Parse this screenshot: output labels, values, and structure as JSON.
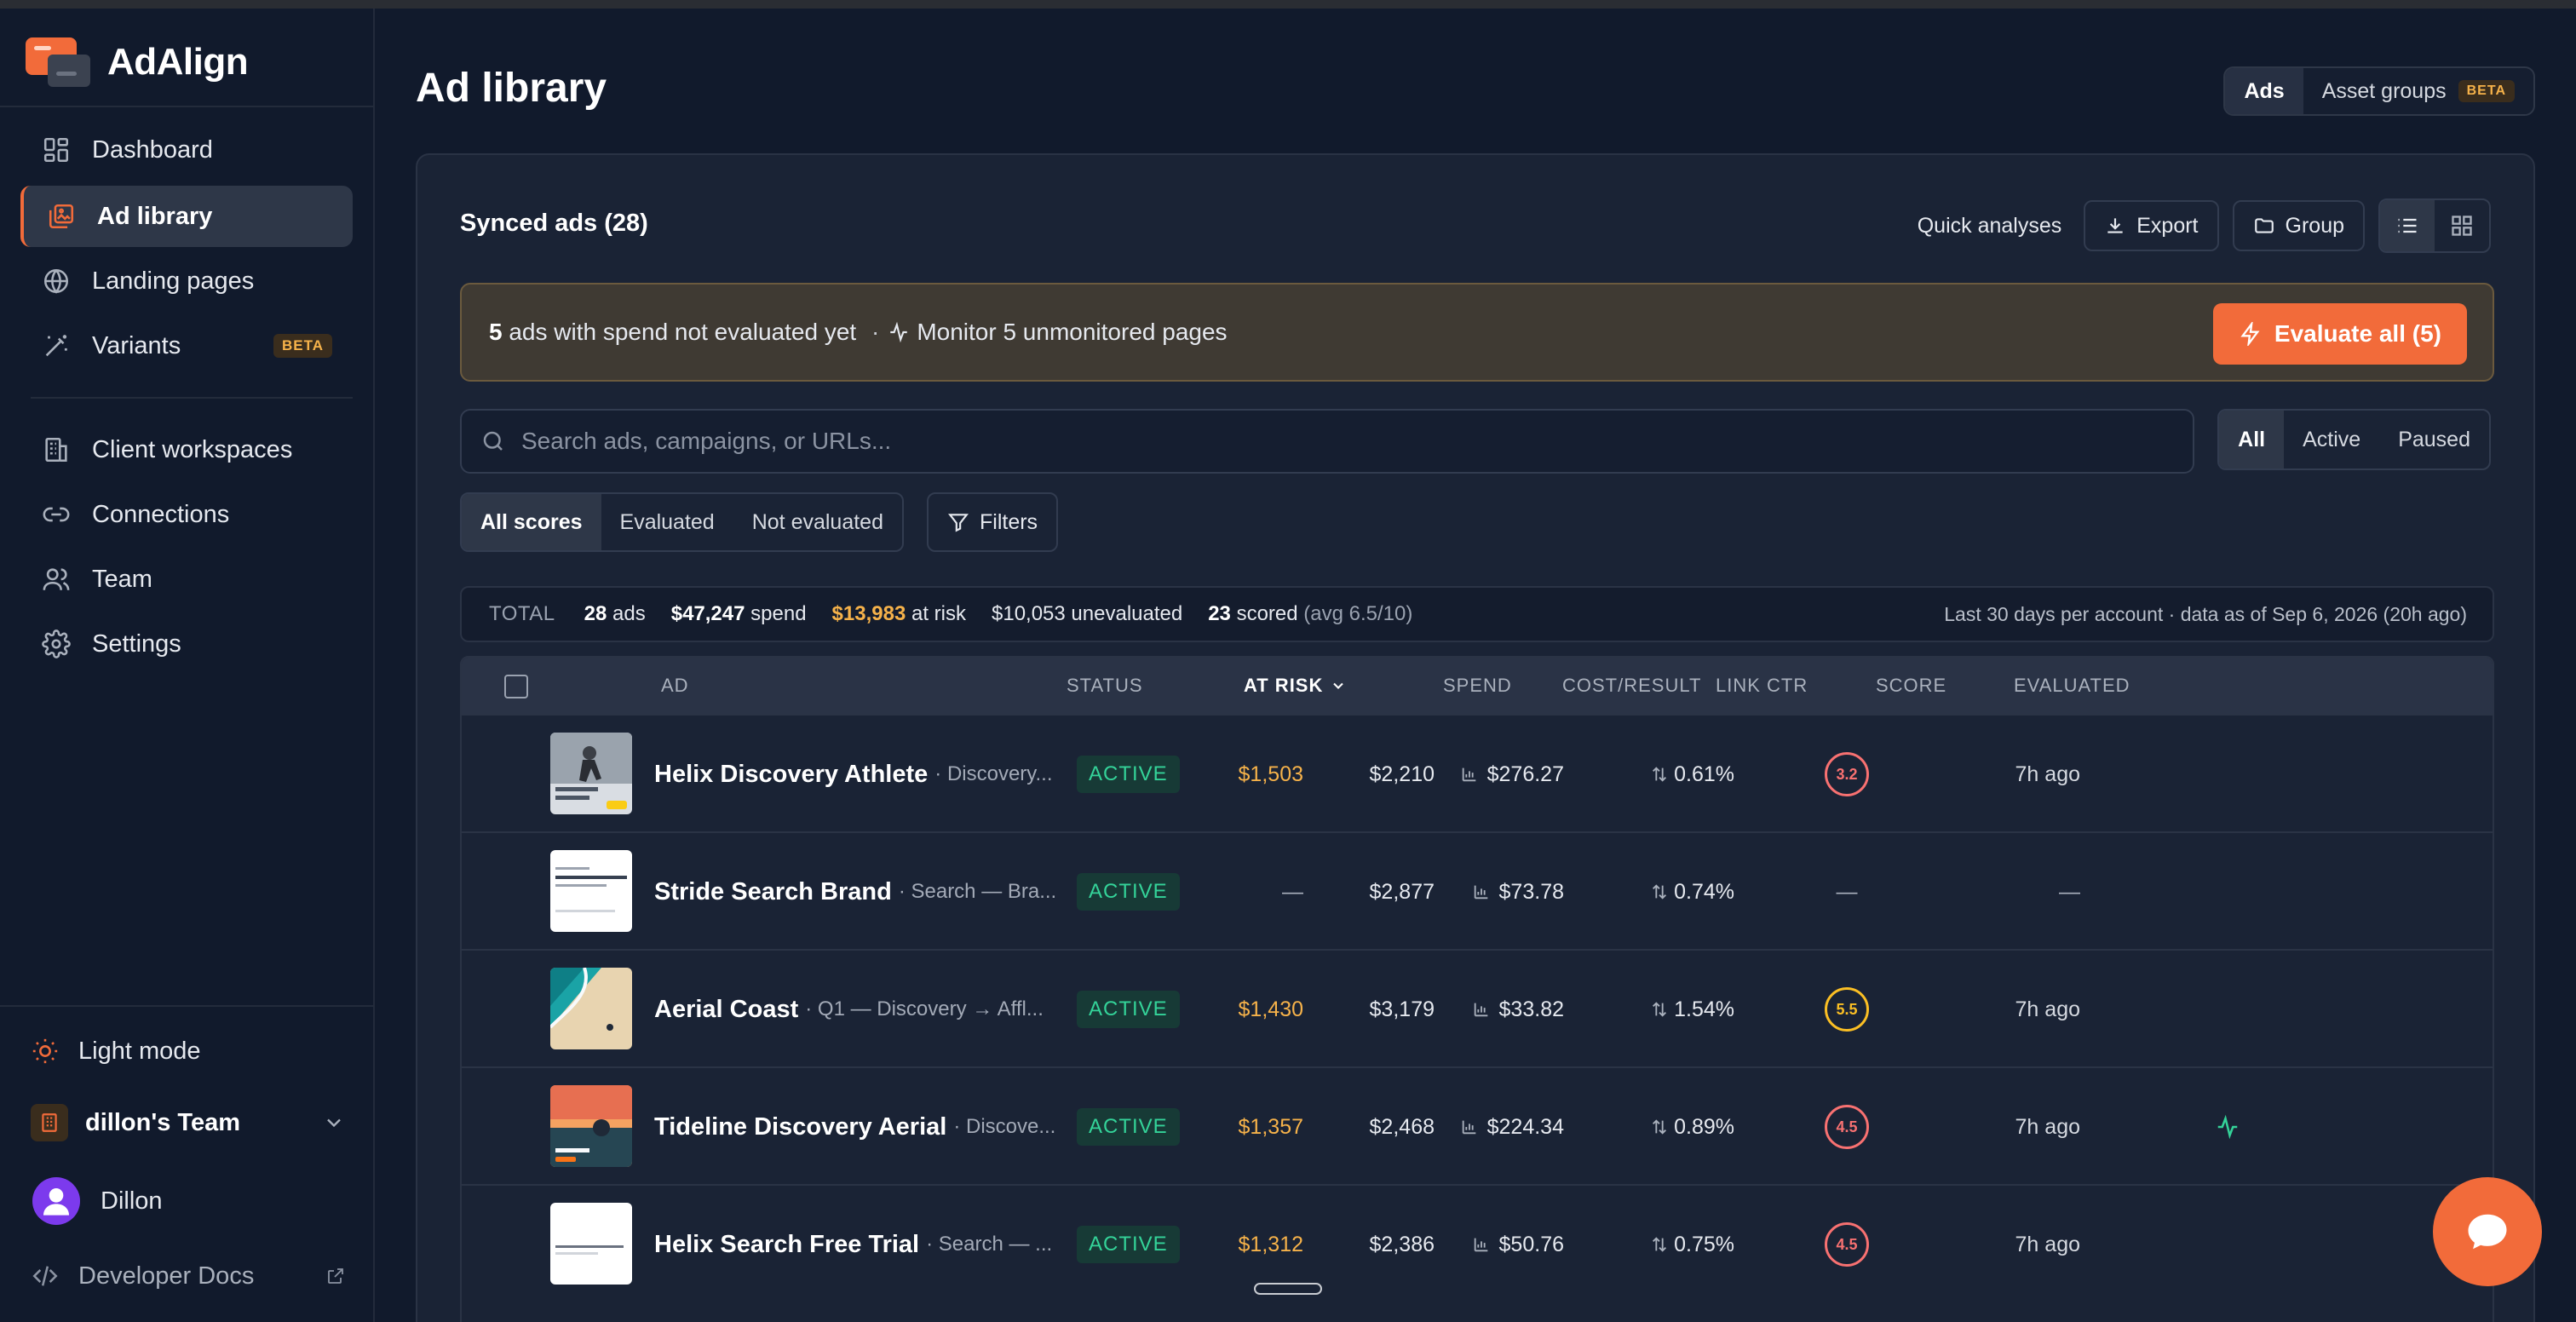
{
  "app": {
    "name": "AdAlign"
  },
  "sidebar": {
    "items": [
      {
        "label": "Dashboard",
        "icon": "dashboard-icon"
      },
      {
        "label": "Ad library",
        "icon": "image-library-icon",
        "active": true
      },
      {
        "label": "Landing pages",
        "icon": "globe-icon"
      },
      {
        "label": "Variants",
        "icon": "magic-wand-icon",
        "badge": "BETA"
      },
      {
        "label": "Client workspaces",
        "icon": "building-icon"
      },
      {
        "label": "Connections",
        "icon": "link-icon"
      },
      {
        "label": "Team",
        "icon": "users-icon"
      },
      {
        "label": "Settings",
        "icon": "gear-icon"
      }
    ],
    "light_mode": "Light mode",
    "team": "dillon's Team",
    "user": "Dillon",
    "developer_docs": "Developer Docs"
  },
  "header": {
    "title": "Ad library",
    "tabs": [
      {
        "label": "Ads",
        "active": true
      },
      {
        "label": "Asset groups",
        "badge": "BETA"
      }
    ]
  },
  "card": {
    "title": "Synced ads (28)",
    "quick_analyses": "Quick analyses",
    "export": "Export",
    "group": "Group"
  },
  "banner": {
    "count": "5",
    "text": "ads with spend not evaluated yet",
    "separator": "·",
    "monitor": "Monitor 5 unmonitored pages",
    "button": "Evaluate all (5)"
  },
  "search": {
    "placeholder": "Search ads, campaigns, or URLs..."
  },
  "status_filter": {
    "options": [
      "All",
      "Active",
      "Paused"
    ],
    "selected": "All"
  },
  "score_filter": {
    "options": [
      "All scores",
      "Evaluated",
      "Not evaluated"
    ],
    "selected": "All scores"
  },
  "filters_label": "Filters",
  "totals": {
    "label": "TOTAL",
    "ads": "28",
    "ads_label": "ads",
    "spend": "$47,247",
    "spend_label": "spend",
    "at_risk": "$13,983",
    "at_risk_label": "at risk",
    "unevaluated": "$10,053 unevaluated",
    "scored": "23",
    "scored_label": "scored",
    "avg": "(avg 6.5/10)",
    "note": "Last 30 days per account · data as of Sep 6, 2026 (20h ago)"
  },
  "table": {
    "columns": [
      "AD",
      "STATUS",
      "AT RISK",
      "SPEND",
      "COST/RESULT",
      "LINK CTR",
      "SCORE",
      "EVALUATED"
    ],
    "rows": [
      {
        "name": "Helix Discovery Athlete",
        "sub": "· Discovery...",
        "status": "ACTIVE",
        "at_risk": "$1,503",
        "spend": "$2,210",
        "cost": "$276.27",
        "ctr": "0.61%",
        "score": "3.2",
        "score_color": "#f87171",
        "evaluated": "7h ago",
        "monitored": false
      },
      {
        "name": "Stride Search Brand",
        "sub": "· Search — Bra...",
        "status": "ACTIVE",
        "at_risk": "—",
        "spend": "$2,877",
        "cost": "$73.78",
        "ctr": "0.74%",
        "score": "—",
        "score_color": "",
        "evaluated": "—",
        "monitored": false
      },
      {
        "name": "Aerial Coast",
        "sub": "· Q1 — Discovery → Affl...",
        "status": "ACTIVE",
        "at_risk": "$1,430",
        "spend": "$3,179",
        "cost": "$33.82",
        "ctr": "1.54%",
        "score": "5.5",
        "score_color": "#fbbf24",
        "evaluated": "7h ago",
        "monitored": false
      },
      {
        "name": "Tideline Discovery Aerial",
        "sub": "· Discove...",
        "status": "ACTIVE",
        "at_risk": "$1,357",
        "spend": "$2,468",
        "cost": "$224.34",
        "ctr": "0.89%",
        "score": "4.5",
        "score_color": "#f87171",
        "evaluated": "7h ago",
        "monitored": true
      },
      {
        "name": "Helix Search Free Trial",
        "sub": "· Search — ...",
        "status": "ACTIVE",
        "at_risk": "$1,312",
        "spend": "$2,386",
        "cost": "$50.76",
        "ctr": "0.75%",
        "score": "4.5",
        "score_color": "#f87171",
        "evaluated": "7h ago",
        "monitored": false
      }
    ]
  },
  "colors": {
    "accent": "#f26b3a",
    "risk": "#f6b24a",
    "active": "#34d399",
    "bg": "#111a2c"
  }
}
